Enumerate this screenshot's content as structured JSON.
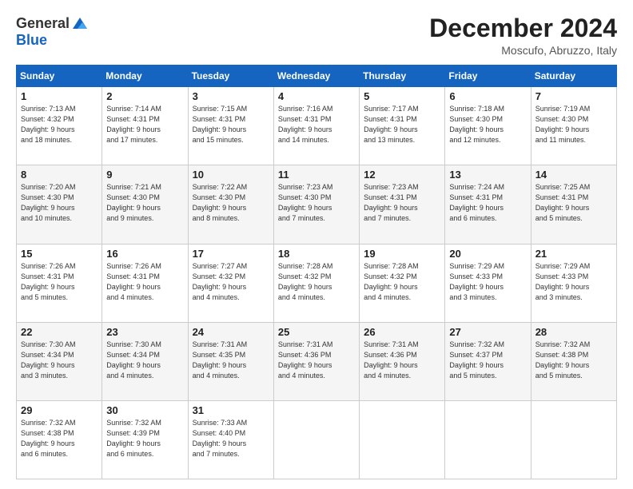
{
  "logo": {
    "general": "General",
    "blue": "Blue"
  },
  "title": "December 2024",
  "location": "Moscufo, Abruzzo, Italy",
  "days_of_week": [
    "Sunday",
    "Monday",
    "Tuesday",
    "Wednesday",
    "Thursday",
    "Friday",
    "Saturday"
  ],
  "weeks": [
    [
      {
        "day": "1",
        "sunrise": "7:13 AM",
        "sunset": "4:32 PM",
        "daylight": "9 hours and 18 minutes."
      },
      {
        "day": "2",
        "sunrise": "7:14 AM",
        "sunset": "4:31 PM",
        "daylight": "9 hours and 17 minutes."
      },
      {
        "day": "3",
        "sunrise": "7:15 AM",
        "sunset": "4:31 PM",
        "daylight": "9 hours and 15 minutes."
      },
      {
        "day": "4",
        "sunrise": "7:16 AM",
        "sunset": "4:31 PM",
        "daylight": "9 hours and 14 minutes."
      },
      {
        "day": "5",
        "sunrise": "7:17 AM",
        "sunset": "4:31 PM",
        "daylight": "9 hours and 13 minutes."
      },
      {
        "day": "6",
        "sunrise": "7:18 AM",
        "sunset": "4:30 PM",
        "daylight": "9 hours and 12 minutes."
      },
      {
        "day": "7",
        "sunrise": "7:19 AM",
        "sunset": "4:30 PM",
        "daylight": "9 hours and 11 minutes."
      }
    ],
    [
      {
        "day": "8",
        "sunrise": "7:20 AM",
        "sunset": "4:30 PM",
        "daylight": "9 hours and 10 minutes."
      },
      {
        "day": "9",
        "sunrise": "7:21 AM",
        "sunset": "4:30 PM",
        "daylight": "9 hours and 9 minutes."
      },
      {
        "day": "10",
        "sunrise": "7:22 AM",
        "sunset": "4:30 PM",
        "daylight": "9 hours and 8 minutes."
      },
      {
        "day": "11",
        "sunrise": "7:23 AM",
        "sunset": "4:30 PM",
        "daylight": "9 hours and 7 minutes."
      },
      {
        "day": "12",
        "sunrise": "7:23 AM",
        "sunset": "4:31 PM",
        "daylight": "9 hours and 7 minutes."
      },
      {
        "day": "13",
        "sunrise": "7:24 AM",
        "sunset": "4:31 PM",
        "daylight": "9 hours and 6 minutes."
      },
      {
        "day": "14",
        "sunrise": "7:25 AM",
        "sunset": "4:31 PM",
        "daylight": "9 hours and 5 minutes."
      }
    ],
    [
      {
        "day": "15",
        "sunrise": "7:26 AM",
        "sunset": "4:31 PM",
        "daylight": "9 hours and 5 minutes."
      },
      {
        "day": "16",
        "sunrise": "7:26 AM",
        "sunset": "4:31 PM",
        "daylight": "9 hours and 4 minutes."
      },
      {
        "day": "17",
        "sunrise": "7:27 AM",
        "sunset": "4:32 PM",
        "daylight": "9 hours and 4 minutes."
      },
      {
        "day": "18",
        "sunrise": "7:28 AM",
        "sunset": "4:32 PM",
        "daylight": "9 hours and 4 minutes."
      },
      {
        "day": "19",
        "sunrise": "7:28 AM",
        "sunset": "4:32 PM",
        "daylight": "9 hours and 4 minutes."
      },
      {
        "day": "20",
        "sunrise": "7:29 AM",
        "sunset": "4:33 PM",
        "daylight": "9 hours and 3 minutes."
      },
      {
        "day": "21",
        "sunrise": "7:29 AM",
        "sunset": "4:33 PM",
        "daylight": "9 hours and 3 minutes."
      }
    ],
    [
      {
        "day": "22",
        "sunrise": "7:30 AM",
        "sunset": "4:34 PM",
        "daylight": "9 hours and 3 minutes."
      },
      {
        "day": "23",
        "sunrise": "7:30 AM",
        "sunset": "4:34 PM",
        "daylight": "9 hours and 4 minutes."
      },
      {
        "day": "24",
        "sunrise": "7:31 AM",
        "sunset": "4:35 PM",
        "daylight": "9 hours and 4 minutes."
      },
      {
        "day": "25",
        "sunrise": "7:31 AM",
        "sunset": "4:36 PM",
        "daylight": "9 hours and 4 minutes."
      },
      {
        "day": "26",
        "sunrise": "7:31 AM",
        "sunset": "4:36 PM",
        "daylight": "9 hours and 4 minutes."
      },
      {
        "day": "27",
        "sunrise": "7:32 AM",
        "sunset": "4:37 PM",
        "daylight": "9 hours and 5 minutes."
      },
      {
        "day": "28",
        "sunrise": "7:32 AM",
        "sunset": "4:38 PM",
        "daylight": "9 hours and 5 minutes."
      }
    ],
    [
      {
        "day": "29",
        "sunrise": "7:32 AM",
        "sunset": "4:38 PM",
        "daylight": "9 hours and 6 minutes."
      },
      {
        "day": "30",
        "sunrise": "7:32 AM",
        "sunset": "4:39 PM",
        "daylight": "9 hours and 6 minutes."
      },
      {
        "day": "31",
        "sunrise": "7:33 AM",
        "sunset": "4:40 PM",
        "daylight": "9 hours and 7 minutes."
      },
      null,
      null,
      null,
      null
    ]
  ]
}
